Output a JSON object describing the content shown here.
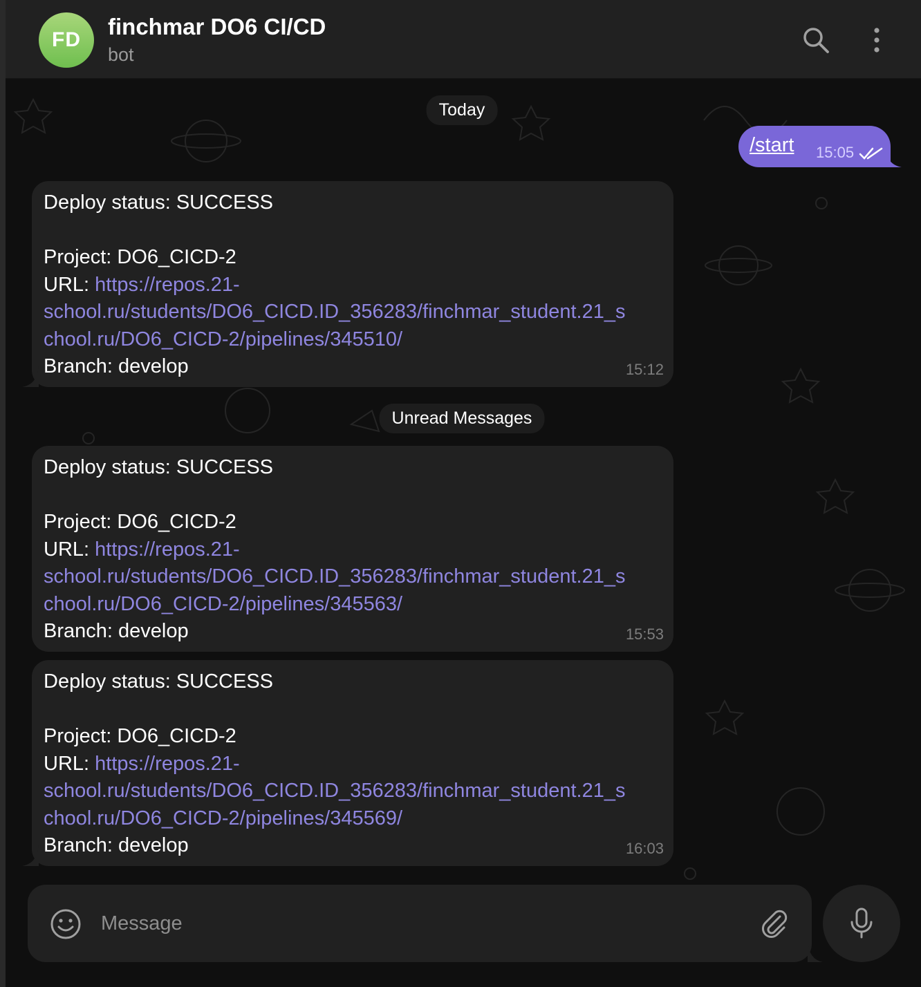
{
  "header": {
    "avatar_initials": "FD",
    "title": "finchmar DO6 CI/CD",
    "subtitle": "bot",
    "icons": [
      "search-icon",
      "more-vertical-icon"
    ]
  },
  "colors": {
    "accent": "#7a67d8",
    "link": "#8f86e0",
    "bubble": "#212121",
    "avatar": "#8ccb64"
  },
  "chat": {
    "date_label": "Today",
    "unread_label": "Unread Messages",
    "outgoing": {
      "text": "/start",
      "time": "15:05",
      "status_icon": "double-check-icon"
    },
    "messages": [
      {
        "status": "Deploy status: SUCCESS",
        "project": "Project: DO6_CICD-2",
        "url_label": "URL: ",
        "url_line1": "https://repos.21-",
        "url_line2": "school.ru/students/DO6_CICD.ID_356283/finchmar_student.21_s",
        "url_line3": "chool.ru/DO6_CICD-2/pipelines/345510/",
        "branch": "Branch: develop",
        "time": "15:12"
      },
      {
        "status": "Deploy status: SUCCESS",
        "project": "Project: DO6_CICD-2",
        "url_label": "URL: ",
        "url_line1": "https://repos.21-",
        "url_line2": "school.ru/students/DO6_CICD.ID_356283/finchmar_student.21_s",
        "url_line3": "chool.ru/DO6_CICD-2/pipelines/345563/",
        "branch": "Branch: develop",
        "time": "15:53"
      },
      {
        "status": "Deploy status: SUCCESS",
        "project": "Project: DO6_CICD-2",
        "url_label": "URL: ",
        "url_line1": "https://repos.21-",
        "url_line2": "school.ru/students/DO6_CICD.ID_356283/finchmar_student.21_s",
        "url_line3": "chool.ru/DO6_CICD-2/pipelines/345569/",
        "branch": "Branch: develop",
        "time": "16:03"
      }
    ]
  },
  "composer": {
    "placeholder": "Message",
    "icons": [
      "emoji-icon",
      "attach-icon",
      "microphone-icon"
    ]
  }
}
